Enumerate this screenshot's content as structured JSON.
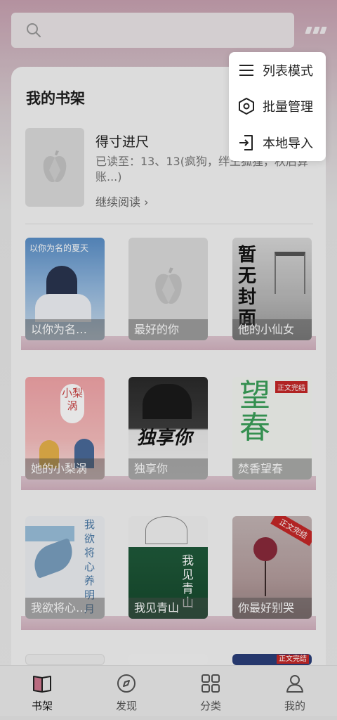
{
  "search": {
    "placeholder": ""
  },
  "menu": {
    "items": [
      {
        "label": "列表模式",
        "icon": "list-icon"
      },
      {
        "label": "批量管理",
        "icon": "hexagon-settings-icon"
      },
      {
        "label": "本地导入",
        "icon": "import-icon"
      }
    ]
  },
  "shelf": {
    "title": "我的书架",
    "recent": {
      "title": "得寸进尺",
      "progress": "已读至：13、13(疯狗，绊王狐狸，秋后算账...)",
      "continue_label": "继续阅读 ›"
    },
    "books": [
      {
        "title": "以你为名…",
        "cover_text": "以你为名的夏天"
      },
      {
        "title": "最好的你",
        "cover_text": ""
      },
      {
        "title": "他的小仙女",
        "cover_text": "暂无封面"
      },
      {
        "title": "她的小梨涡",
        "cover_text": "小梨涡"
      },
      {
        "title": "独享你",
        "cover_text": "独享你"
      },
      {
        "title": "焚香望春",
        "cover_text": "望春"
      },
      {
        "title": "我欲将心…",
        "cover_text": "我欲将心养明月"
      },
      {
        "title": "我见青山",
        "cover_text": "我见青山"
      },
      {
        "title": "你最好别哭",
        "cover_text": "正文完结"
      }
    ],
    "next_row_badge": "正文完结"
  },
  "nav": {
    "items": [
      {
        "label": "书架",
        "icon": "book-icon",
        "active": true
      },
      {
        "label": "发现",
        "icon": "compass-icon",
        "active": false
      },
      {
        "label": "分类",
        "icon": "grid-icon",
        "active": false
      },
      {
        "label": "我的",
        "icon": "user-icon",
        "active": false
      }
    ]
  },
  "colors": {
    "accent": "#c9a2b2",
    "shelf_plank": "#d9bcc8",
    "active_icon": "#d0788f"
  }
}
